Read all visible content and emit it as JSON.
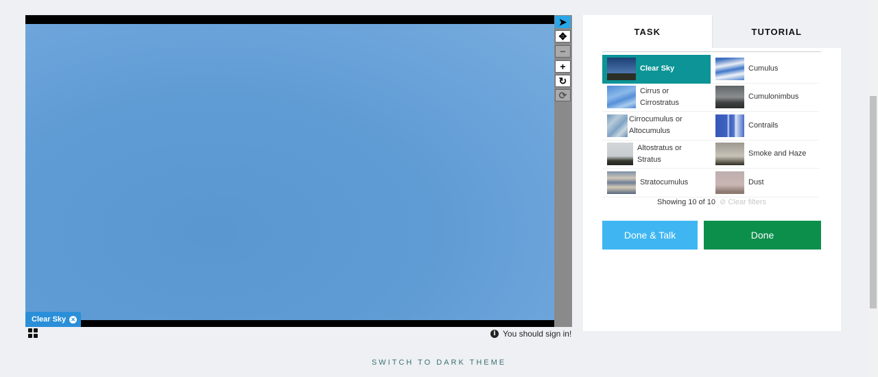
{
  "viewer": {
    "active_annotation": "Clear Sky",
    "remove_icon": "close-icon",
    "status_message": "You should sign in!"
  },
  "toolbar": {
    "tools": [
      {
        "name": "pointer",
        "icon": "arrow-cursor-icon",
        "glyph": "➤",
        "state": "active"
      },
      {
        "name": "pan",
        "icon": "move-arrows-icon",
        "glyph": "✥",
        "state": "normal"
      },
      {
        "name": "zoom-out",
        "icon": "minus-icon",
        "glyph": "−",
        "state": "disabled"
      },
      {
        "name": "zoom-in",
        "icon": "plus-icon",
        "glyph": "+",
        "state": "normal"
      },
      {
        "name": "rotate",
        "icon": "rotate-icon",
        "glyph": "↻",
        "state": "normal"
      },
      {
        "name": "reset",
        "icon": "refresh-icon",
        "glyph": "⟳",
        "state": "disabled"
      }
    ]
  },
  "panel": {
    "tabs": [
      {
        "label": "TASK",
        "active": true
      },
      {
        "label": "TUTORIAL",
        "active": false
      }
    ],
    "choices": [
      {
        "label": "Clear Sky",
        "selected": true
      },
      {
        "label": "Cumulus",
        "selected": false
      },
      {
        "label": "Cirrus or Cirrostratus",
        "selected": false
      },
      {
        "label": "Cumulonimbus",
        "selected": false
      },
      {
        "label": "Cirrocumulus or Altocumulus",
        "selected": false
      },
      {
        "label": "Contrails",
        "selected": false
      },
      {
        "label": "Altostratus or Stratus",
        "selected": false
      },
      {
        "label": "Smoke and Haze",
        "selected": false
      },
      {
        "label": "Stratocumulus",
        "selected": false
      },
      {
        "label": "Dust",
        "selected": false
      }
    ],
    "showing_text": "Showing 10 of 10",
    "clear_filters": "Clear filters",
    "done_talk_label": "Done & Talk",
    "done_label": "Done"
  },
  "footer": {
    "theme_toggle": "SWITCH TO DARK THEME"
  }
}
